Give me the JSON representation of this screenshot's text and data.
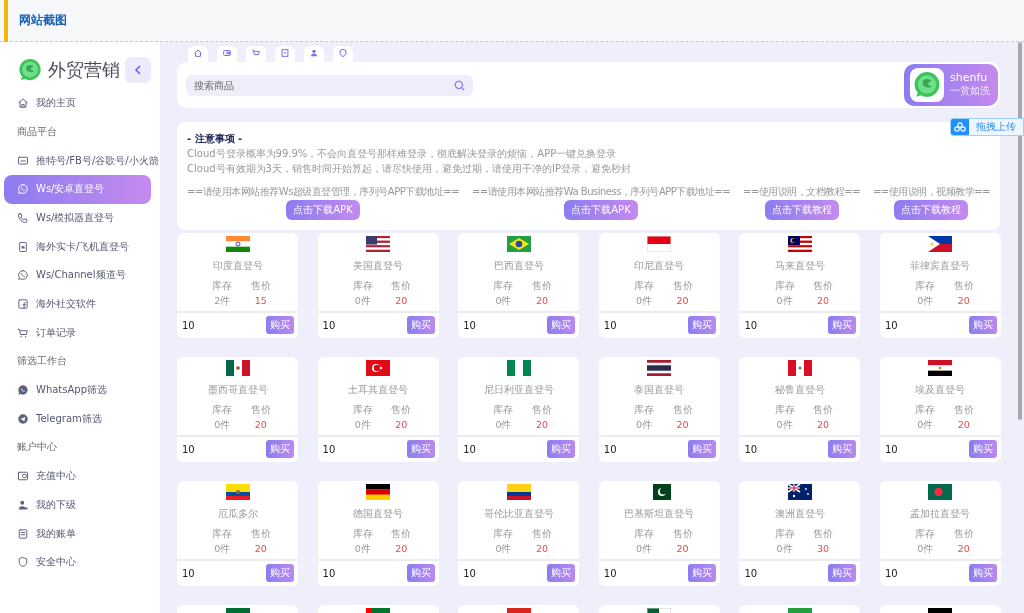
{
  "header": {
    "title": "网站截图"
  },
  "sidebar": {
    "logo_text": "外贸营销",
    "items": [
      {
        "kind": "link",
        "label": "我的主页",
        "selected": false
      },
      {
        "kind": "section",
        "label": "商品平台"
      },
      {
        "kind": "link",
        "label": "推特号/FB号/谷歌号/小火箭",
        "selected": false
      },
      {
        "kind": "link",
        "label": "Ws/安卓直登号",
        "selected": true
      },
      {
        "kind": "link",
        "label": "Ws/模拟器直登号",
        "selected": false
      },
      {
        "kind": "link",
        "label": "海外实卡/飞机直登号",
        "selected": false
      },
      {
        "kind": "link",
        "label": "Ws/Channel频道号",
        "selected": false
      },
      {
        "kind": "link",
        "label": "海外社交软件",
        "selected": false
      },
      {
        "kind": "link",
        "label": "订单记录",
        "selected": false
      },
      {
        "kind": "section",
        "label": "筛选工作台"
      },
      {
        "kind": "link",
        "label": "WhatsApp筛选",
        "selected": false
      },
      {
        "kind": "link",
        "label": "Telegram筛选",
        "selected": false
      },
      {
        "kind": "section",
        "label": "账户中心"
      },
      {
        "kind": "link",
        "label": "充值中心",
        "selected": false
      },
      {
        "kind": "link",
        "label": "我的下级",
        "selected": false
      },
      {
        "kind": "link",
        "label": "我的账单",
        "selected": false
      },
      {
        "kind": "link",
        "label": "安全中心",
        "selected": false
      }
    ]
  },
  "search": {
    "placeholder": "搜索商品"
  },
  "profile": {
    "name": "shenfu",
    "subtitle": "一贫如洗"
  },
  "upload_widget": {
    "label": "拖拽上传"
  },
  "notice": {
    "title": "- 注意事项 -",
    "lines": [
      "Cloud号登录概率为99.9%，不会向直登号那样难登录，彻底解决登录的烦恼，APP一键兑换登录",
      "Cloud号有效期为3天，销售时间开始算起，请尽快使用，避免过期，请使用干净的IP登录，避免秒封"
    ],
    "downloads": [
      {
        "text": "==请使用本网站推荐Ws超级直登管理，序列号APP下载地址==",
        "button": "点击下载APK"
      },
      {
        "text": "==请使用本网站推荐Wa Business，序列号APP下载地址==",
        "button": "点击下载APK"
      },
      {
        "text": "==使用说明，文档教程==",
        "button": "点击下载教程"
      },
      {
        "text": "==使用说明，视频教学==",
        "button": "点击下载教程"
      }
    ]
  },
  "products": [
    {
      "name": "印度直登号",
      "stock_label": "库存",
      "price_label": "售价",
      "stock": "2件",
      "price": "15",
      "quantity": "10",
      "button": "购买"
    },
    {
      "name": "美国直登号",
      "stock_label": "库存",
      "price_label": "售价",
      "stock": "0件",
      "price": "20",
      "quantity": "10",
      "button": "购买"
    },
    {
      "name": "巴西直登号",
      "stock_label": "库存",
      "price_label": "售价",
      "stock": "0件",
      "price": "20",
      "quantity": "10",
      "button": "购买"
    },
    {
      "name": "印尼直登号",
      "stock_label": "库存",
      "price_label": "售价",
      "stock": "0件",
      "price": "20",
      "quantity": "10",
      "button": "购买"
    },
    {
      "name": "马来直登号",
      "stock_label": "库存",
      "price_label": "售价",
      "stock": "0件",
      "price": "20",
      "quantity": "10",
      "button": "购买"
    },
    {
      "name": "菲律宾直登号",
      "stock_label": "库存",
      "price_label": "售价",
      "stock": "0件",
      "price": "20",
      "quantity": "10",
      "button": "购买"
    },
    {
      "name": "墨西哥直登号",
      "stock_label": "库存",
      "price_label": "售价",
      "stock": "0件",
      "price": "20",
      "quantity": "10",
      "button": "购买"
    },
    {
      "name": "土耳其直登号",
      "stock_label": "库存",
      "price_label": "售价",
      "stock": "0件",
      "price": "20",
      "quantity": "10",
      "button": "购买"
    },
    {
      "name": "尼日利亚直登号",
      "stock_label": "库存",
      "price_label": "售价",
      "stock": "0件",
      "price": "20",
      "quantity": "10",
      "button": "购买"
    },
    {
      "name": "泰国直登号",
      "stock_label": "库存",
      "price_label": "售价",
      "stock": "0件",
      "price": "20",
      "quantity": "10",
      "button": "购买"
    },
    {
      "name": "秘鲁直登号",
      "stock_label": "库存",
      "price_label": "售价",
      "stock": "0件",
      "price": "20",
      "quantity": "10",
      "button": "购买"
    },
    {
      "name": "埃及直登号",
      "stock_label": "库存",
      "price_label": "售价",
      "stock": "0件",
      "price": "20",
      "quantity": "10",
      "button": "购买"
    },
    {
      "name": "厄瓜多尔",
      "stock_label": "库存",
      "price_label": "售价",
      "stock": "0件",
      "price": "20",
      "quantity": "10",
      "button": "购买"
    },
    {
      "name": "德国直登号",
      "stock_label": "库存",
      "price_label": "售价",
      "stock": "0件",
      "price": "20",
      "quantity": "10",
      "button": "购买"
    },
    {
      "name": "哥伦比亚直登号",
      "stock_label": "库存",
      "price_label": "售价",
      "stock": "0件",
      "price": "20",
      "quantity": "10",
      "button": "购买"
    },
    {
      "name": "巴基斯坦直登号",
      "stock_label": "库存",
      "price_label": "售价",
      "stock": "0件",
      "price": "20",
      "quantity": "10",
      "button": "购买"
    },
    {
      "name": "澳洲直登号",
      "stock_label": "库存",
      "price_label": "售价",
      "stock": "0件",
      "price": "30",
      "quantity": "10",
      "button": "购买"
    },
    {
      "name": "孟加拉直登号",
      "stock_label": "库存",
      "price_label": "售价",
      "stock": "0件",
      "price": "20",
      "quantity": "10",
      "button": "购买"
    }
  ]
}
